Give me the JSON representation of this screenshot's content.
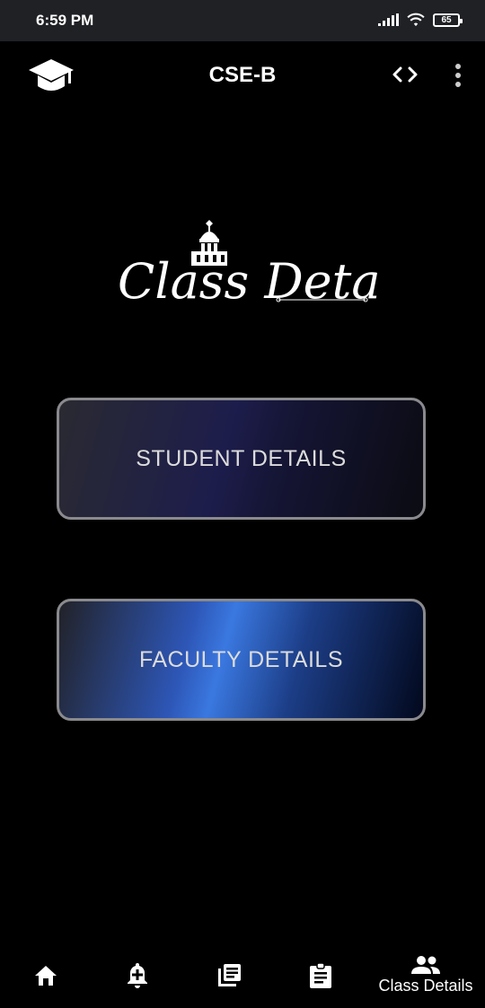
{
  "status": {
    "time": "6:59 PM",
    "battery": "65"
  },
  "appbar": {
    "title": "CSE-B",
    "logo_icon": "graduation-cap-icon",
    "code_icon": "code-icon",
    "menu_icon": "more-vert-icon"
  },
  "hero": {
    "title": "Class Details"
  },
  "buttons": {
    "student": "STUDENT DETAILS",
    "faculty": "FACULTY DETAILS"
  },
  "nav": {
    "items": [
      {
        "icon": "home-icon"
      },
      {
        "icon": "add-alert-icon"
      },
      {
        "icon": "library-books-icon"
      },
      {
        "icon": "assignment-icon"
      },
      {
        "icon": "people-icon",
        "label": "Class Details",
        "active": true
      }
    ]
  }
}
